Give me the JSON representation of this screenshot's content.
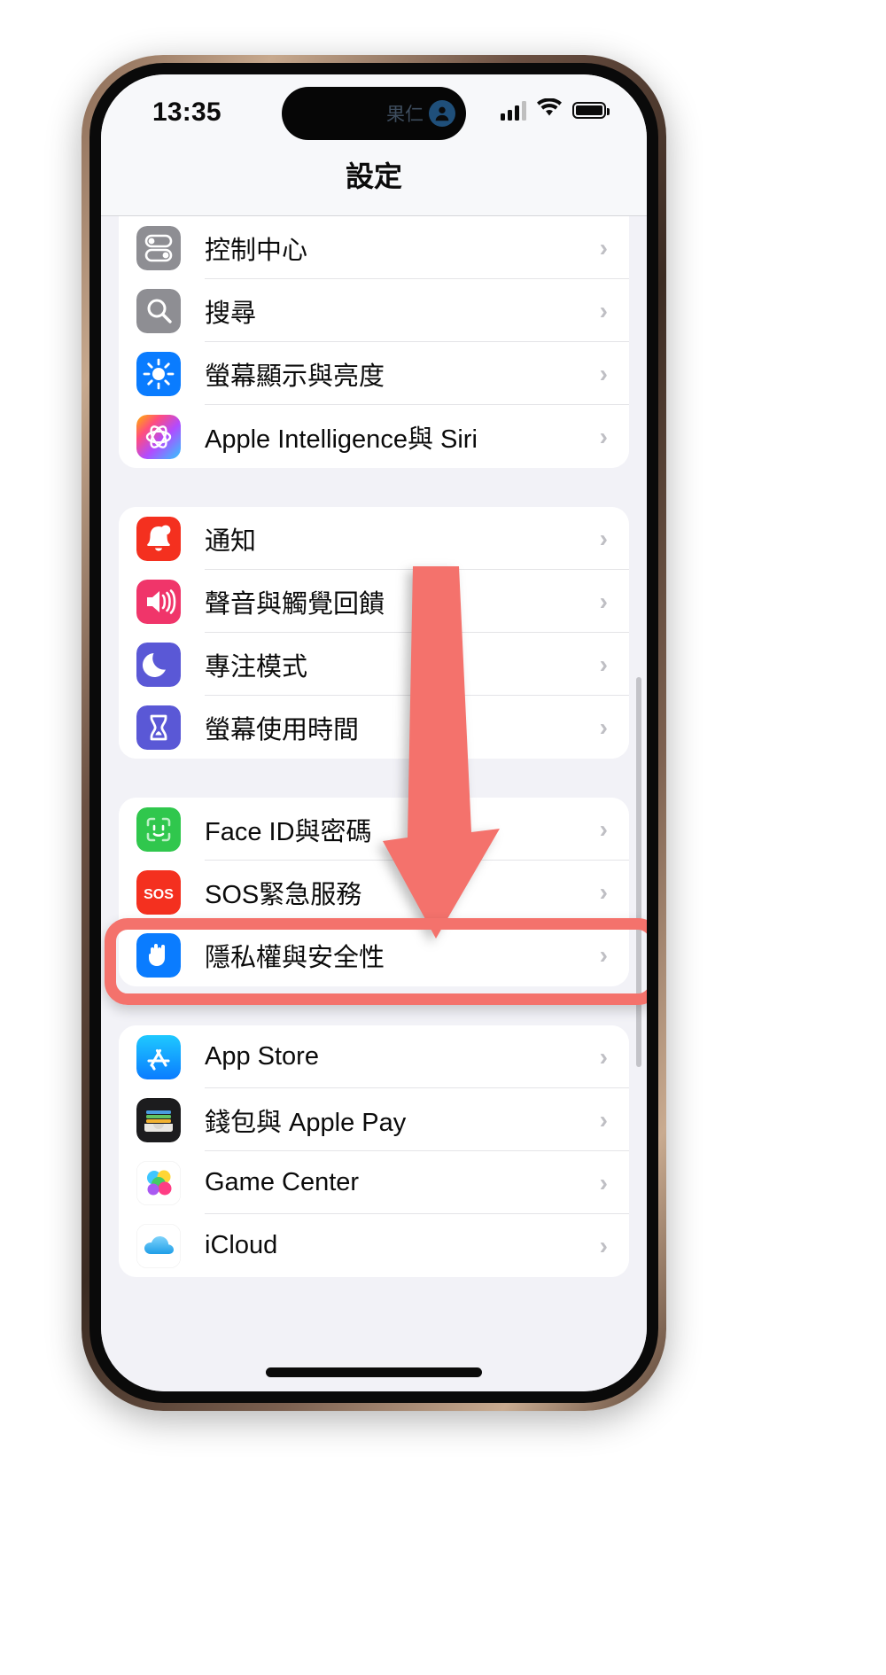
{
  "status_bar": {
    "time": "13:35",
    "dynamic_island_label": "果仁",
    "dynamic_island_avatar_icon": "person-circle-icon",
    "cellular_icon": "cellular-signal-icon",
    "wifi_icon": "wifi-icon",
    "battery_icon": "battery-full-icon"
  },
  "nav": {
    "title": "設定"
  },
  "groups": [
    {
      "id": "group-system",
      "rows": [
        {
          "label": "控制中心",
          "icon": "control-center-icon",
          "icon_color": "#8e8e93",
          "chevron": "›"
        },
        {
          "label": "搜尋",
          "icon": "search-icon",
          "icon_color": "#8e8e93",
          "chevron": "›"
        },
        {
          "label": "螢幕顯示與亮度",
          "icon": "brightness-icon",
          "icon_color": "#0a7cff",
          "chevron": "›"
        },
        {
          "label": "Apple Intelligence與 Siri",
          "icon": "apple-intelligence-icon",
          "icon_color": "#ff4fa0",
          "chevron": "›"
        }
      ]
    },
    {
      "id": "group-alerts",
      "rows": [
        {
          "label": "通知",
          "icon": "notifications-bell-icon",
          "icon_color": "#f4301f",
          "chevron": "›"
        },
        {
          "label": "聲音與觸覺回饋",
          "icon": "sound-speaker-icon",
          "icon_color": "#f0356a",
          "chevron": "›"
        },
        {
          "label": "專注模式",
          "icon": "focus-moon-icon",
          "icon_color": "#5a58d6",
          "chevron": "›"
        },
        {
          "label": "螢幕使用時間",
          "icon": "screen-time-hourglass-icon",
          "icon_color": "#5a58d6",
          "chevron": "›"
        }
      ]
    },
    {
      "id": "group-security",
      "rows": [
        {
          "label": "Face ID與密碼",
          "icon": "face-id-icon",
          "icon_color": "#30c74d",
          "chevron": "›"
        },
        {
          "label": "SOS緊急服務",
          "icon": "sos-icon",
          "icon_color": "#f4301f",
          "chevron": "›"
        },
        {
          "label": "隱私權與安全性",
          "icon": "privacy-hand-icon",
          "icon_color": "#0a7cff",
          "chevron": "›"
        }
      ]
    },
    {
      "id": "group-services",
      "rows": [
        {
          "label": "App Store",
          "icon": "app-store-icon",
          "icon_color": "#18aaf7",
          "chevron": "›"
        },
        {
          "label": "錢包與 Apple Pay",
          "icon": "wallet-icon",
          "icon_color": "#1c1c1e",
          "chevron": "›"
        },
        {
          "label": "Game Center",
          "icon": "game-center-icon",
          "icon_color": "#ffffff",
          "chevron": "›"
        },
        {
          "label": "iCloud",
          "icon": "icloud-icon",
          "icon_color": "#ffffff",
          "chevron": "›"
        }
      ]
    }
  ],
  "annotation": {
    "highlight_color": "#f4726c",
    "arrow_color": "#f4726c",
    "highlighted_row_label": "螢幕使用時間",
    "arrow_icon": "down-arrow-icon"
  }
}
